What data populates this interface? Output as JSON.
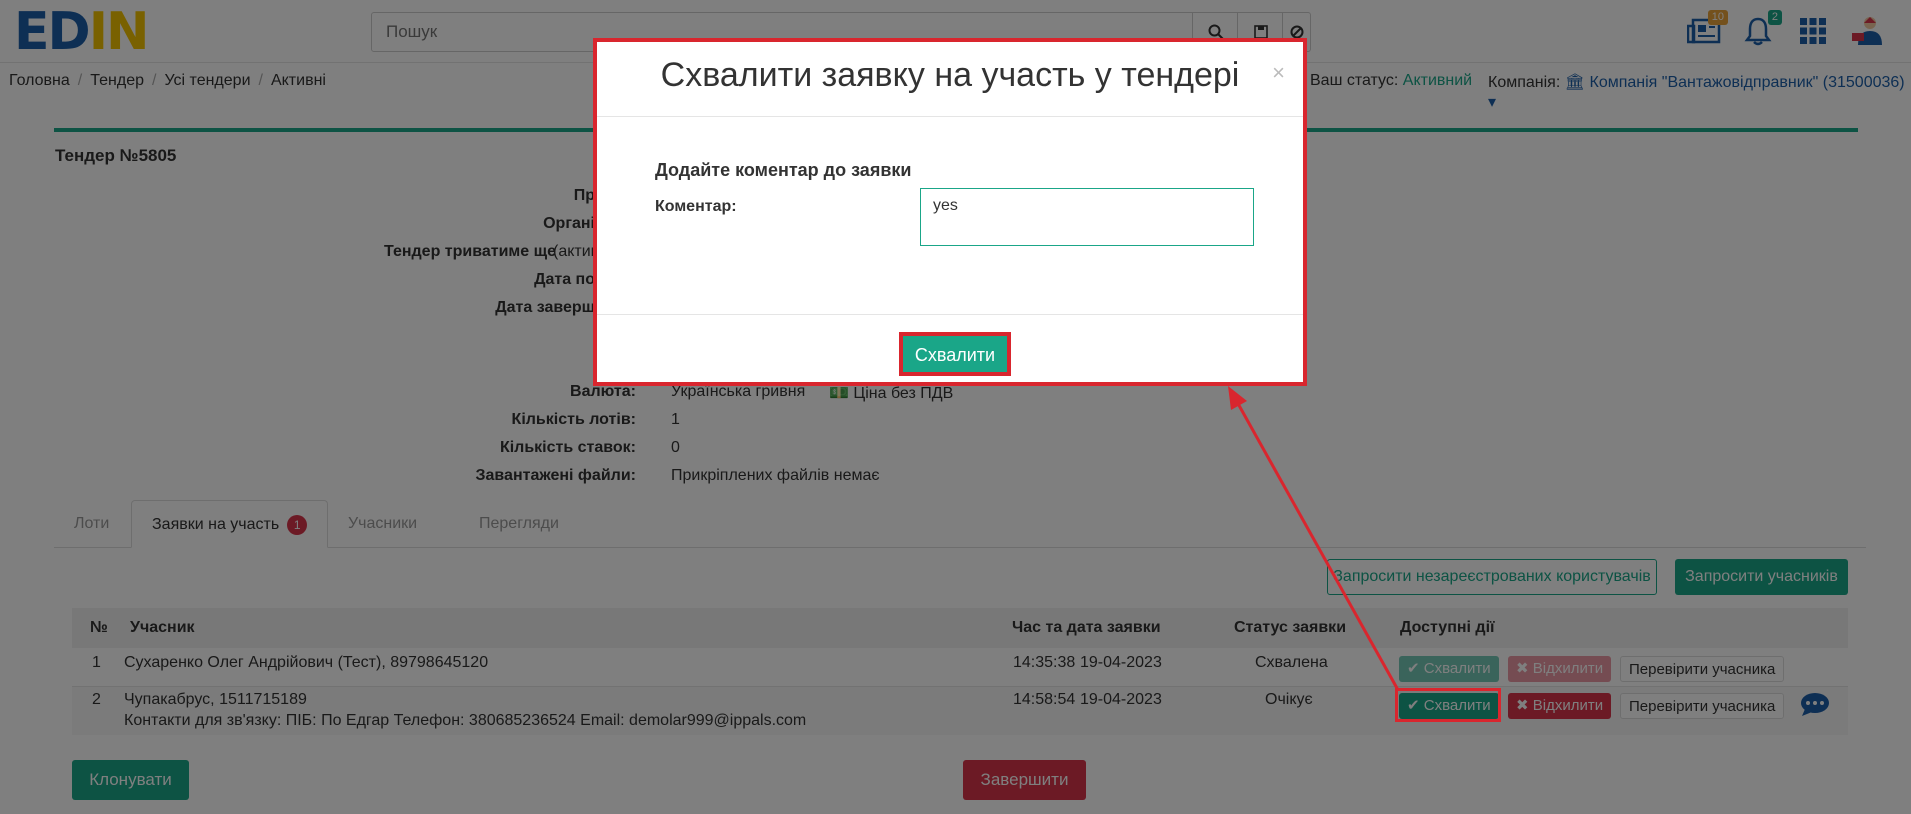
{
  "header": {
    "logo_left": "ED",
    "logo_mid": "I",
    "logo_right": "N",
    "search_placeholder": "Пошук",
    "icons": [
      "search-icon",
      "save-icon",
      "ban-icon",
      "newspaper-icon",
      "bell-icon",
      "apps-grid-icon",
      "user-avatar"
    ],
    "news_count": "10",
    "notifications_count": "2",
    "colors": {
      "brand_blue": "#1d5fa8",
      "brand_yellow": "#f2c200",
      "accent": "#1aa688",
      "danger": "#d9344b"
    }
  },
  "breadcrumb": [
    "Головна",
    "Тендер",
    "Усі тендери",
    "Активні"
  ],
  "status": {
    "label": "Ваш статус:",
    "value": "Активний"
  },
  "company": {
    "label": "Компанія:",
    "value": "Компанія \"Вантажовідправник\" (31500036)"
  },
  "tender": {
    "title": "Тендер №5805",
    "fields": [
      {
        "label": "Пр",
        "value": ""
      },
      {
        "label": "Органі",
        "value": ""
      },
      {
        "label": "Тендер триватиме ще",
        "value": "(актив"
      },
      {
        "label": "Дата по",
        "value": ""
      },
      {
        "label": "Дата заверш",
        "value": ""
      },
      {
        "label": "Валюта:",
        "value": "Українська гривня"
      },
      {
        "label": "Кількість лотів:",
        "value": "1"
      },
      {
        "label": "Кількість ставок:",
        "value": "0"
      },
      {
        "label": "Завантажені файли:",
        "value": "Прикріплених файлів немає"
      }
    ],
    "price_note": "Ціна без ПДВ"
  },
  "tabs": [
    {
      "label": "Лоти"
    },
    {
      "label": "Заявки на участь",
      "badge": "1"
    },
    {
      "label": "Учасники"
    },
    {
      "label": "Перегляди"
    }
  ],
  "actions": {
    "invite_unregistered": "Запросити незареєстрованих користувачів",
    "invite_participants": "Запросити учасників"
  },
  "table": {
    "headers": [
      "№",
      "Учасник",
      "Час та дата заявки",
      "Статус заявки",
      "Доступні дії"
    ],
    "rows": [
      {
        "num": "1",
        "participant": "Сухаренко Олег Андрійович (Тест), 89798645120",
        "contacts": "",
        "time": "14:35:38",
        "date": "19-04-2023",
        "status": "Схвалена"
      },
      {
        "num": "2",
        "participant": "Чупакабрус, 1511715189",
        "contacts": "Контакти для зв'язку: ПІБ: По Едгар   Телефон: 380685236524   Email: demolar999@ippals.com",
        "time": "14:58:54",
        "date": "19-04-2023",
        "status": "Очікує"
      }
    ],
    "approve_label": "Схвалити",
    "reject_label": "Відхилити",
    "check_label": "Перевірити учасника"
  },
  "footer": {
    "clone_label": "Клонувати",
    "finish_label": "Завершити"
  },
  "modal": {
    "title": "Схвалити заявку на участь у тендері",
    "close": "×",
    "subtitle": "Додайте коментар до заявки",
    "comment_label": "Коментар:",
    "comment_value": "yes",
    "approve_button": "Схвалити"
  }
}
